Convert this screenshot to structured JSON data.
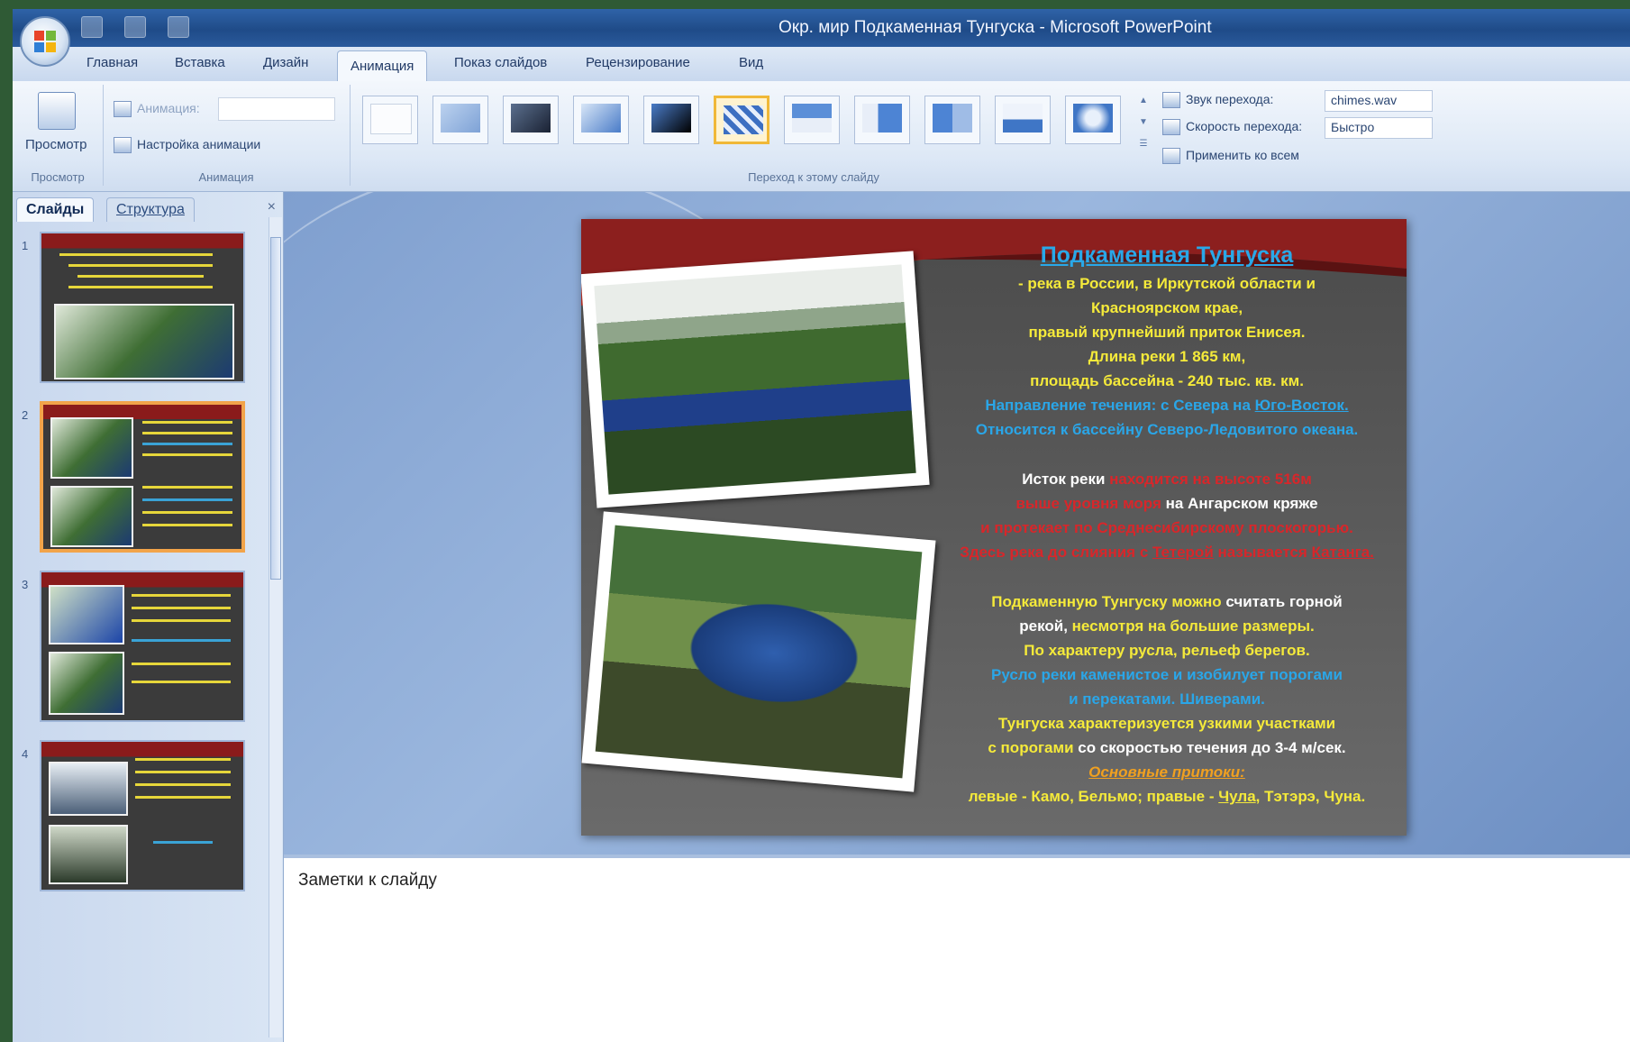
{
  "window": {
    "title": "Окр. мир Подкаменная Тунгуска - Microsoft PowerPoint"
  },
  "tabs": [
    "Главная",
    "Вставка",
    "Дизайн",
    "Анимация",
    "Показ слайдов",
    "Рецензирование",
    "Вид"
  ],
  "active_tab": "Анимация",
  "ribbon": {
    "preview": {
      "button_label": "Просмотр",
      "group_label": "Просмотр"
    },
    "animation": {
      "animation_label": "Анимация:",
      "custom_label": "Настройка анимации",
      "group_label": "Анимация"
    },
    "transition": {
      "sound_label": "Звук перехода:",
      "sound_value": "chimes.wav",
      "speed_label": "Скорость перехода:",
      "speed_value": "Быстро",
      "apply_all_label": "Применить ко всем",
      "group_label": "Переход к этому слайду"
    }
  },
  "panel": {
    "tab_slides": "Слайды",
    "tab_outline": "Структура",
    "close": "×",
    "slide_numbers": [
      "1",
      "2",
      "3",
      "4"
    ],
    "selected_slide": 2
  },
  "slide": {
    "title": "Подкаменная Тунгуска",
    "l1": "- река в России, в Иркутской области и",
    "l2": "Красноярском крае,",
    "l3": "правый крупнейший приток Енисея.",
    "l4": "Длина реки 1 865 км,",
    "l5": "площадь бассейна - 240 тыс. кв. км.",
    "l6a": "Направление течения: с Севера на ",
    "l6b": "Юго-Восток.",
    "l7": "Относится к бассейну Северо-Ледовитого океана.",
    "l8a": "Исток реки ",
    "l8b": "находится на высоте 516м",
    "l9a": "выше уровня моря ",
    "l9b": "на Ангарском кряже",
    "l10": "и протекает по Среднесибирскому плоскогорью.",
    "l11a": "Здесь река до слияния с ",
    "l11b": "Тетерой",
    "l11c": " называется ",
    "l11d": "Катанга.",
    "l12a": "Подкаменную Тунгуску можно ",
    "l12b": "считать горной",
    "l13a": "рекой, ",
    "l13b": "несмотря на большие размеры.",
    "l14": "По характеру русла, рельеф берегов.",
    "l15": "Русло реки каменистое и изобилует порогами",
    "l16a": "и перекатами.",
    "l16b": " Шиверами.",
    "l17": "Тунгуска характеризуется узкими участками",
    "l18a": "с порогами ",
    "l18b": "со скоростью течения до 3-4 м/сек.",
    "l19": "Основные притоки:",
    "l20a": "левые - Камо, Бельмо; правые - ",
    "l20b": "Чула",
    "l20c": ", Тэтэрэ, Чуна."
  },
  "notes": {
    "placeholder": "Заметки к слайду"
  },
  "colors": {
    "ribbon_accent": "#f0b838",
    "slide_title": "#29a8e8",
    "slide_text_yellow": "#f5ea3a",
    "slide_text_red": "#d8262a",
    "selected_thumb_border": "#f2a44a"
  }
}
